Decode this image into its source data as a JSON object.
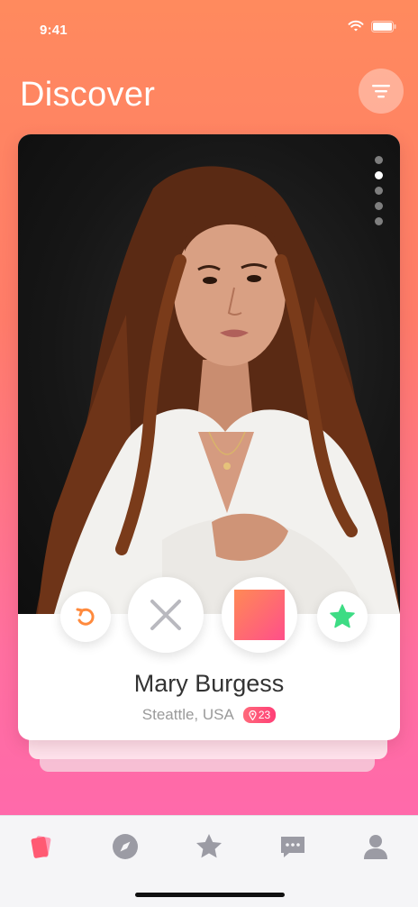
{
  "status_bar": {
    "time": "9:41"
  },
  "header": {
    "title": "Discover"
  },
  "profile": {
    "name": "Mary Burgess",
    "location": "Steattle, USA",
    "distance": "23",
    "photo_count": 5,
    "active_photo_index": 1
  },
  "actions": {
    "undo_icon": "undo-icon",
    "nope_icon": "close-icon",
    "like_icon": "like-square",
    "super_like_icon": "star-icon"
  },
  "tabs": [
    {
      "name": "cards-icon",
      "active": true
    },
    {
      "name": "compass-icon",
      "active": false
    },
    {
      "name": "star-icon",
      "active": false
    },
    {
      "name": "chat-icon",
      "active": false
    },
    {
      "name": "profile-icon",
      "active": false
    }
  ],
  "colors": {
    "gradient_top": "#ff8a5e",
    "gradient_bottom": "#ff66b0",
    "accent_orange": "#ff8a3d",
    "accent_pink": "#ff4f8a",
    "super_like_green": "#3ddc84",
    "tab_inactive": "#9b9ba4"
  }
}
